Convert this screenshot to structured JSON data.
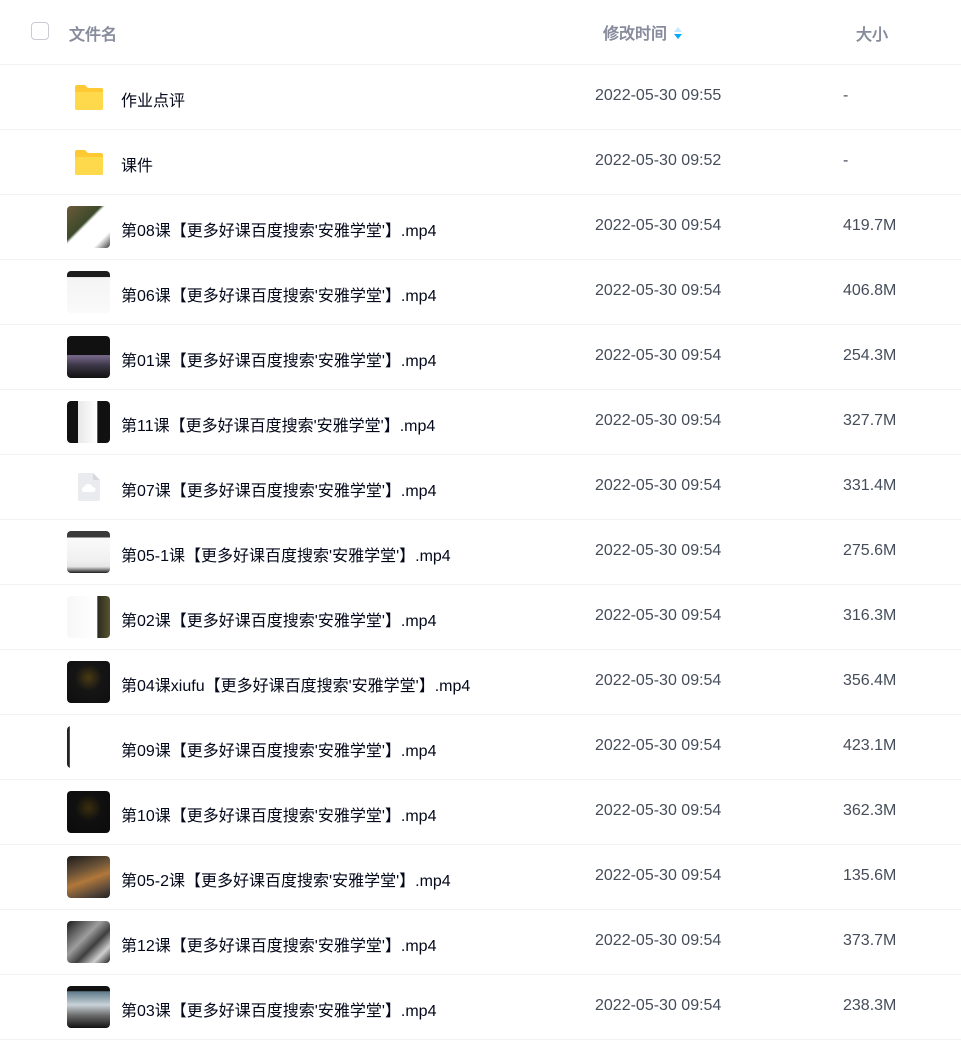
{
  "header": {
    "name_label": "文件名",
    "time_label": "修改时间",
    "size_label": "大小"
  },
  "files": [
    {
      "name": "作业点评",
      "time": "2022-05-30 09:55",
      "size": "-",
      "icon": "folder-icon"
    },
    {
      "name": "课件",
      "time": "2022-05-30 09:52",
      "size": "-",
      "icon": "folder-icon"
    },
    {
      "name": "第08课【更多好课百度搜索'安雅学堂'】.mp4",
      "time": "2022-05-30 09:54",
      "size": "419.7M",
      "icon": "video-thumbnail"
    },
    {
      "name": "第06课【更多好课百度搜索'安雅学堂'】.mp4",
      "time": "2022-05-30 09:54",
      "size": "406.8M",
      "icon": "video-thumbnail"
    },
    {
      "name": "第01课【更多好课百度搜索'安雅学堂'】.mp4",
      "time": "2022-05-30 09:54",
      "size": "254.3M",
      "icon": "video-thumbnail"
    },
    {
      "name": "第11课【更多好课百度搜索'安雅学堂'】.mp4",
      "time": "2022-05-30 09:54",
      "size": "327.7M",
      "icon": "video-thumbnail"
    },
    {
      "name": "第07课【更多好课百度搜索'安雅学堂'】.mp4",
      "time": "2022-05-30 09:54",
      "size": "331.4M",
      "icon": "cloud-file-icon"
    },
    {
      "name": "第05-1课【更多好课百度搜索'安雅学堂'】.mp4",
      "time": "2022-05-30 09:54",
      "size": "275.6M",
      "icon": "video-thumbnail"
    },
    {
      "name": "第02课【更多好课百度搜索'安雅学堂'】.mp4",
      "time": "2022-05-30 09:54",
      "size": "316.3M",
      "icon": "video-thumbnail"
    },
    {
      "name": "第04课xiufu【更多好课百度搜索'安雅学堂'】.mp4",
      "time": "2022-05-30 09:54",
      "size": "356.4M",
      "icon": "video-thumbnail"
    },
    {
      "name": "第09课【更多好课百度搜索'安雅学堂'】.mp4",
      "time": "2022-05-30 09:54",
      "size": "423.1M",
      "icon": "video-thumbnail"
    },
    {
      "name": "第10课【更多好课百度搜索'安雅学堂'】.mp4",
      "time": "2022-05-30 09:54",
      "size": "362.3M",
      "icon": "video-thumbnail"
    },
    {
      "name": "第05-2课【更多好课百度搜索'安雅学堂'】.mp4",
      "time": "2022-05-30 09:54",
      "size": "135.6M",
      "icon": "video-thumbnail"
    },
    {
      "name": "第12课【更多好课百度搜索'安雅学堂'】.mp4",
      "time": "2022-05-30 09:54",
      "size": "373.7M",
      "icon": "video-thumbnail"
    },
    {
      "name": "第03课【更多好课百度搜索'安雅学堂'】.mp4",
      "time": "2022-05-30 09:54",
      "size": "238.3M",
      "icon": "video-thumbnail"
    }
  ],
  "colors": {
    "folder": "#ffd73d",
    "sort_accent": "#06a7ff",
    "header_text": "#878c9c",
    "row_border": "#f1f2f4"
  }
}
